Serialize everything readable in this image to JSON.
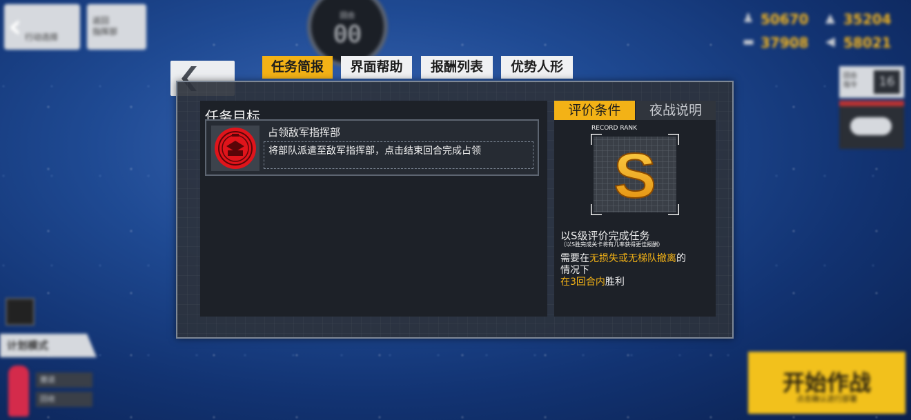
{
  "hud": {
    "back_label": "行动选择",
    "menu2_label_1": "返回",
    "menu2_label_2": "指挥部",
    "turn_label": "回合",
    "turn_number": "00",
    "resources": {
      "manpower": "50670",
      "ammo": "35204",
      "ration": "37908",
      "parts": "58021"
    },
    "right_stat_label_1": "回合",
    "right_stat_label_2": "指令",
    "right_stat_value": "16",
    "plan_mode": "计划模式",
    "left_btn_1": "撤退",
    "left_btn_2": "回收",
    "start_label": "开始作战",
    "start_sub": "点击确认进行部署"
  },
  "tabs": [
    "任务简报",
    "界面帮助",
    "报酬列表",
    "优势人形"
  ],
  "mission": {
    "section_title": "任务目标",
    "objective_name": "占领敌军指挥部",
    "objective_desc": "将部队派遣至敌军指挥部，点击结束回合完成占领"
  },
  "evaluation": {
    "tabs": [
      "评价条件",
      "夜战说明"
    ],
    "rank_label": "RECORD RANK",
    "rank": "S",
    "title": "以S级评价完成任务",
    "subtitle": "（以S胜完成关卡将有几率获得更佳报酬）",
    "line1_pre": "需要在",
    "line1_hl": "无损失或无梯队撤离",
    "line1_post": "的",
    "line2": "情况下",
    "line3_hl": "在3回合内",
    "line3_post": "胜利"
  },
  "colors": {
    "accent": "#f3b216",
    "panel": "#2c323c",
    "badge_red": "#e0141b"
  }
}
